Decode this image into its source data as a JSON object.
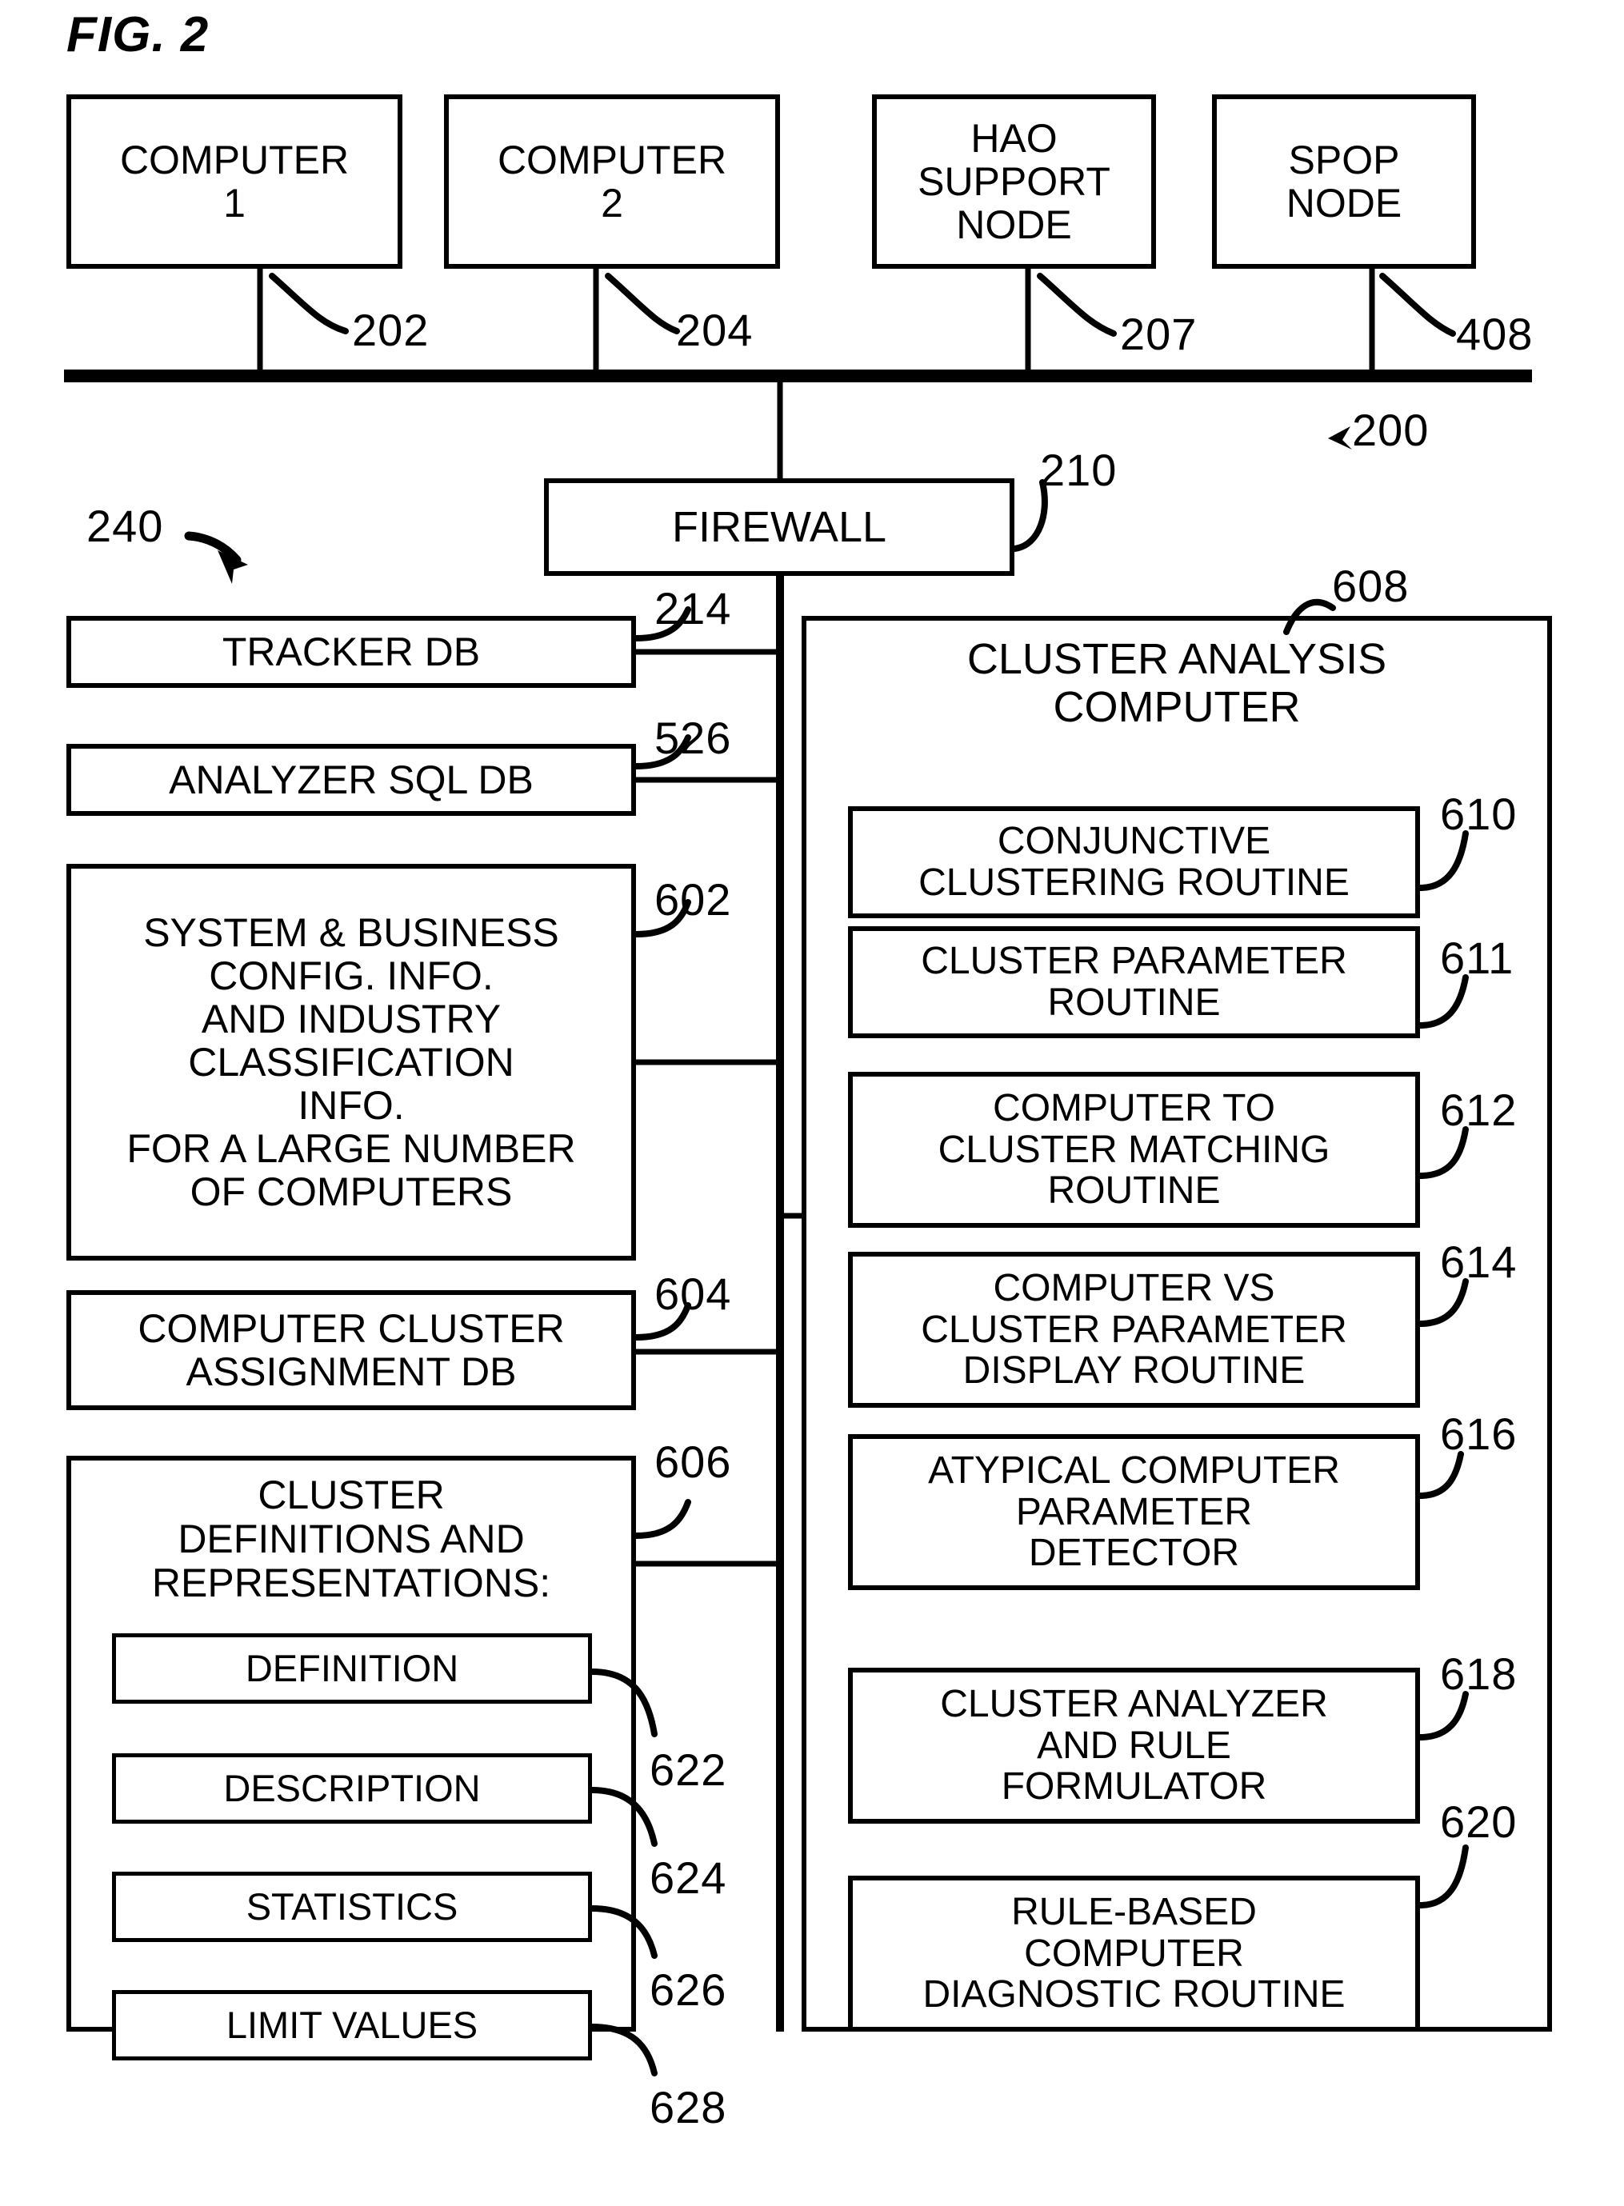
{
  "figure": {
    "title": "FIG. 2",
    "system_ref": "200",
    "group_ref": "240"
  },
  "top_nodes": [
    {
      "label": "COMPUTER\n1",
      "ref": "202"
    },
    {
      "label": "COMPUTER\n2",
      "ref": "204"
    },
    {
      "label": "HAO\nSUPPORT\nNODE",
      "ref": "207"
    },
    {
      "label": "SPOP\nNODE",
      "ref": "408"
    }
  ],
  "firewall": {
    "label": "FIREWALL",
    "ref": "210"
  },
  "left_column": [
    {
      "label": "TRACKER DB",
      "ref": "214"
    },
    {
      "label": "ANALYZER SQL DB",
      "ref": "526"
    },
    {
      "label": "SYSTEM & BUSINESS\nCONFIG. INFO.\nAND INDUSTRY\nCLASSIFICATION\nINFO.\nFOR A LARGE NUMBER\nOF COMPUTERS",
      "ref": "602"
    },
    {
      "label": "COMPUTER CLUSTER\nASSIGNMENT DB",
      "ref": "604"
    },
    {
      "label": "CLUSTER\nDEFINITIONS AND\nREPRESENTATIONS:",
      "ref": "606"
    }
  ],
  "cluster_definition_items": [
    {
      "label": "DEFINITION",
      "ref": "622"
    },
    {
      "label": "DESCRIPTION",
      "ref": "624"
    },
    {
      "label": "STATISTICS",
      "ref": "626"
    },
    {
      "label": "LIMIT VALUES",
      "ref": "628"
    }
  ],
  "analysis_computer": {
    "label": "CLUSTER ANALYSIS\nCOMPUTER",
    "ref": "608",
    "routines": [
      {
        "label": "CONJUNCTIVE\nCLUSTERING ROUTINE",
        "ref": "610"
      },
      {
        "label": "CLUSTER PARAMETER\nROUTINE",
        "ref": "611"
      },
      {
        "label": "COMPUTER TO\nCLUSTER MATCHING\nROUTINE",
        "ref": "612"
      },
      {
        "label": "COMPUTER VS\nCLUSTER PARAMETER\nDISPLAY ROUTINE",
        "ref": "614"
      },
      {
        "label": "ATYPICAL COMPUTER\nPARAMETER\nDETECTOR",
        "ref": "616"
      },
      {
        "label": "CLUSTER ANALYZER\nAND RULE\nFORMULATOR",
        "ref": "618"
      },
      {
        "label": "RULE-BASED\nCOMPUTER\nDIAGNOSTIC ROUTINE",
        "ref": "620"
      }
    ]
  },
  "colors": {
    "ink": "#000000",
    "paper": "#ffffff"
  }
}
